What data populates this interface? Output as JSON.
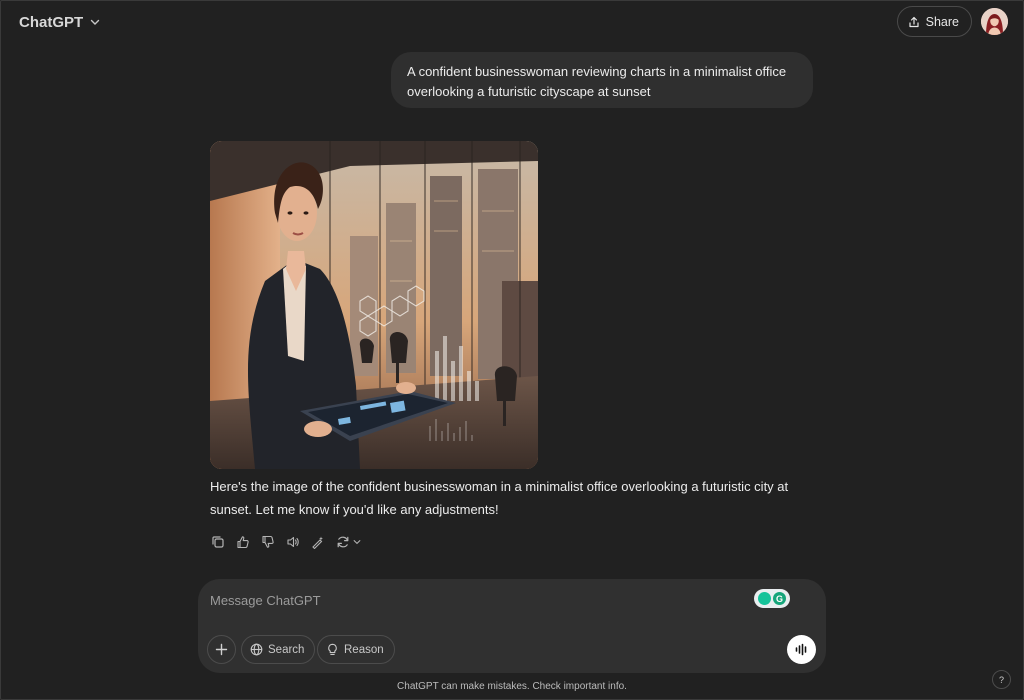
{
  "header": {
    "model_name": "ChatGPT",
    "share_label": "Share"
  },
  "conversation": {
    "user_prompt": "A confident businesswoman reviewing charts in a minimalist office overlooking a futuristic cityscape at sunset",
    "assistant_reply": "Here's the image of the confident businesswoman in a minimalist office overlooking a futuristic city at sunset. Let me know if you'd like any adjustments!",
    "message_actions": [
      "copy-icon",
      "thumbs-up-icon",
      "thumbs-down-icon",
      "read-aloud-icon",
      "edit-image-icon",
      "regenerate-icon"
    ]
  },
  "composer": {
    "placeholder": "Message ChatGPT",
    "search_label": "Search",
    "reason_label": "Reason"
  },
  "footer": {
    "disclaimer": "ChatGPT can make mistakes. Check important info.",
    "help_label": "?"
  },
  "colors": {
    "background": "#212121",
    "bubble": "#2f2f2f",
    "composer": "#303030",
    "text": "#ececec",
    "grammarly_green": "#15c39a"
  }
}
